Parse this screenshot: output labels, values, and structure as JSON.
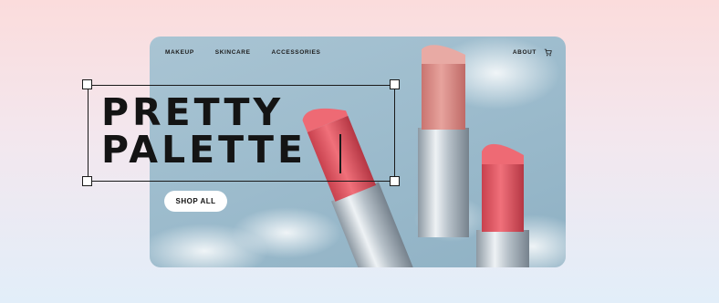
{
  "nav": {
    "links": [
      "MAKEUP",
      "SKINCARE",
      "ACCESSORIES"
    ],
    "about": "ABOUT",
    "cart_icon": "cart-icon"
  },
  "hero": {
    "title_line1": "PRETTY",
    "title_line2": "PALETTE",
    "cta_label": "SHOP ALL"
  },
  "colors": {
    "background_top": "#fbdcdc",
    "background_bottom": "#e2eef9",
    "card": "#9dbccd",
    "lipstick_pink": "#d98a86",
    "lipstick_red": "#e25a64",
    "text": "#141414"
  }
}
